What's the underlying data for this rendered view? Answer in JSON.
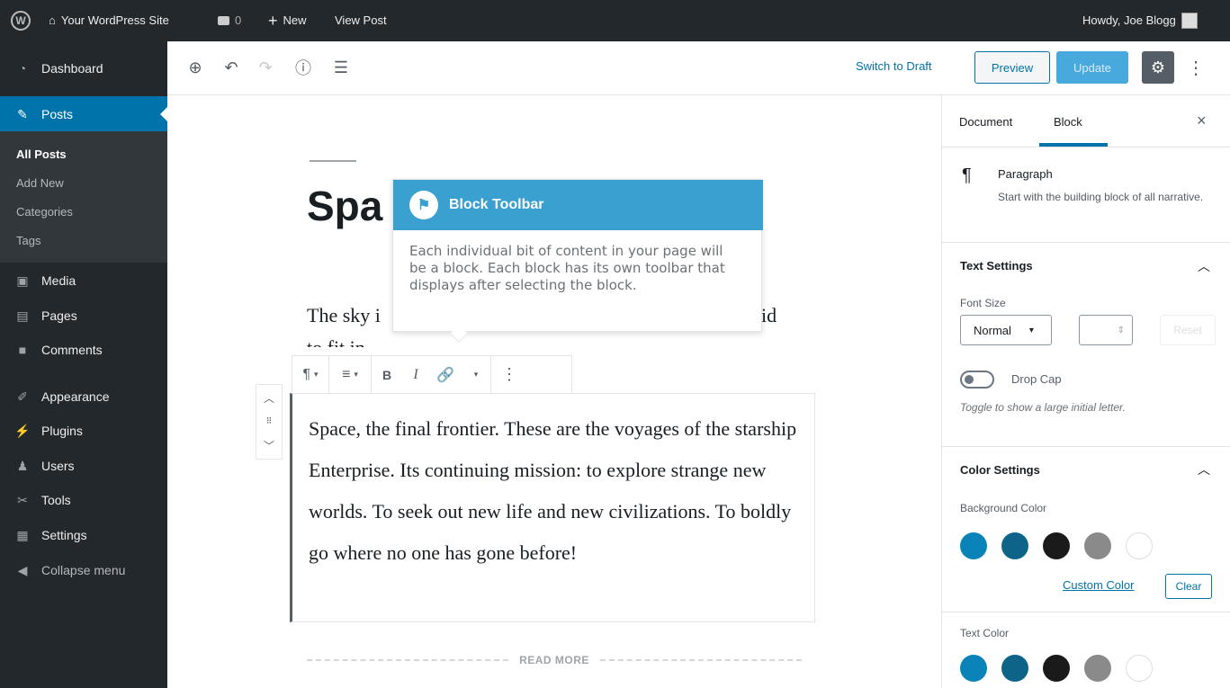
{
  "admin_bar": {
    "site_name": "Your WordPress Site",
    "comments_count": "0",
    "new_label": "New",
    "view_post": "View Post",
    "howdy": "Howdy, Joe Blogg"
  },
  "sidebar": {
    "items": [
      {
        "label": "Dashboard",
        "icon": "dashboard-icon"
      },
      {
        "label": "Posts",
        "icon": "pin-icon"
      },
      {
        "label": "Media",
        "icon": "media-icon"
      },
      {
        "label": "Pages",
        "icon": "pages-icon"
      },
      {
        "label": "Comments",
        "icon": "comments-icon"
      },
      {
        "label": "Appearance",
        "icon": "brush-icon"
      },
      {
        "label": "Plugins",
        "icon": "plug-icon"
      },
      {
        "label": "Users",
        "icon": "users-icon"
      },
      {
        "label": "Tools",
        "icon": "wrench-icon"
      },
      {
        "label": "Settings",
        "icon": "settings-icon"
      },
      {
        "label": "Collapse menu",
        "icon": "collapse-icon"
      }
    ],
    "submenu": [
      "All Posts",
      "Add New",
      "Categories",
      "Tags"
    ]
  },
  "header": {
    "switch_to_draft": "Switch to Draft",
    "preview": "Preview",
    "update": "Update"
  },
  "content": {
    "title_visible": "Spa",
    "para_start": "The sky i",
    "para_end": "id",
    "para_line2": "to fit in",
    "block_text": "Space, the final frontier. These are the voyages of the starship Enterprise. Its  continuing mission: to explore strange new worlds. To seek out new life  and new civilizations. To boldly go where no one has gone before!",
    "read_more": "READ MORE"
  },
  "popover": {
    "title": "Block Toolbar",
    "body": "Each individual bit of content in your page will be a block. Each block has its own toolbar that displays after selecting the block."
  },
  "settings": {
    "tabs": [
      "Document",
      "Block"
    ],
    "block_name": "Paragraph",
    "block_desc": "Start with the building block of all narrative.",
    "text_settings": "Text Settings",
    "font_size_label": "Font Size",
    "font_size_value": "Normal",
    "reset": "Reset",
    "drop_cap": "Drop Cap",
    "drop_cap_help": "Toggle to show a large initial letter.",
    "color_settings": "Color Settings",
    "background_color": "Background Color",
    "custom_color": "Custom Color",
    "clear": "Clear",
    "text_color": "Text Color",
    "swatches": [
      "#0a84b8",
      "#0e6389",
      "#1a1a1a",
      "#8a8a8a",
      "#ffffff"
    ]
  },
  "colors": {
    "admin_bg": "#23282d",
    "accent": "#0073aa",
    "popover_head": "#3aa0d0"
  }
}
